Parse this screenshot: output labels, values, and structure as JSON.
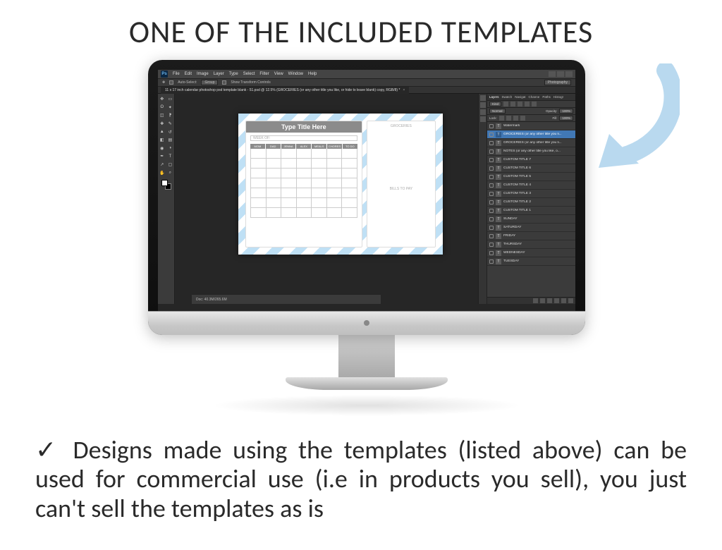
{
  "heading": "ONE OF THE INCLUDED TEMPLATES",
  "caption_check": "✓",
  "caption": " Designs made using the templates (listed above) can be used for commercial use (i.e in products you sell), you just can't sell the templates as is",
  "photoshop": {
    "menus": [
      "File",
      "Edit",
      "Image",
      "Layer",
      "Type",
      "Select",
      "Filter",
      "View",
      "Window",
      "Help"
    ],
    "options": {
      "auto_select_label": "Auto-Select:",
      "auto_select_value": "Group",
      "show_transform": "Show Transform Controls",
      "workspace": "Photography"
    },
    "doc_tab": "11 x 17 inch calendar photoshop psd template blank - 51.psd @ 12.5% (GROCERIES (or any other title you like, or hide to leave blank) copy, RGB/8) *",
    "status": "Doc: 40.3M/265.6M",
    "layers_panel": {
      "tabs": [
        "Layers",
        "Swatch",
        "Navigat",
        "Channe",
        "Paths",
        "Histogr"
      ],
      "kind": "Kind",
      "blend": "Normal",
      "opacity_label": "Opacity:",
      "opacity": "100%",
      "lock_label": "Lock:",
      "fill_label": "Fill:",
      "fill": "100%",
      "layers": [
        {
          "name": "Watermark",
          "sel": false
        },
        {
          "name": "GROCERIES (or any other title you li...",
          "sel": true
        },
        {
          "name": "GROCERIES (or any other title you li...",
          "sel": false
        },
        {
          "name": "NOTES (or any other title you like, o...",
          "sel": false
        },
        {
          "name": "CUSTOM TITLE 7",
          "sel": false
        },
        {
          "name": "CUSTOM TITLE 6",
          "sel": false
        },
        {
          "name": "CUSTOM TITLE 5",
          "sel": false
        },
        {
          "name": "CUSTOM TITLE 4",
          "sel": false
        },
        {
          "name": "CUSTOM TITLE 3",
          "sel": false
        },
        {
          "name": "CUSTOM TITLE 2",
          "sel": false
        },
        {
          "name": "CUSTOM TITLE 1",
          "sel": false
        },
        {
          "name": "SUNDAY",
          "sel": false
        },
        {
          "name": "SATURDAY",
          "sel": false
        },
        {
          "name": "FRIDAY",
          "sel": false
        },
        {
          "name": "THURSDAY",
          "sel": false
        },
        {
          "name": "WEDNESDAY",
          "sel": false
        },
        {
          "name": "TUESDAY",
          "sel": false
        }
      ]
    },
    "template": {
      "title": "Type Title Here",
      "weekof": "WEEK OF:",
      "columns": [
        "MOM",
        "DAD",
        "JENNA",
        "ALEX",
        "MEALS",
        "CHORES",
        "TO DO"
      ],
      "right_top": "GROCERIES",
      "right_bottom": "BILLS TO PAY"
    }
  },
  "colors": {
    "arrow": "#b9d9ef"
  }
}
